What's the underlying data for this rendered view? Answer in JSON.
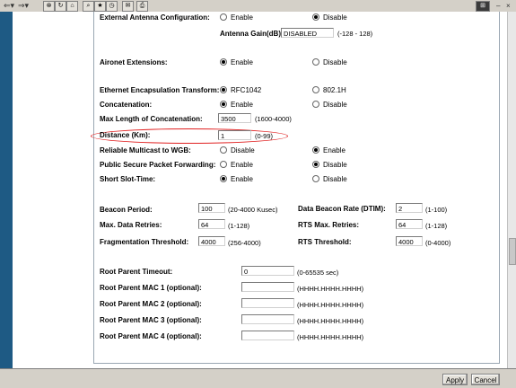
{
  "toolbar": {
    "icons": [
      "back-arrow-icon",
      "forward-arrow-icon",
      "stop-icon",
      "refresh-icon",
      "home-icon",
      "search-icon",
      "favorites-icon",
      "history-icon",
      "mail-icon",
      "print-icon"
    ],
    "window_controls": [
      "–",
      "×"
    ]
  },
  "form": {
    "ext_antenna": {
      "label": "External Antenna Configuration:",
      "opt1": "Enable",
      "opt2": "Disable"
    },
    "antenna_gain": {
      "label": "Antenna Gain(dB):",
      "value": "DISABLED",
      "hint": "(-128 - 128)"
    },
    "aironet": {
      "label": "Aironet Extensions:",
      "opt1": "Enable",
      "opt2": "Disable"
    },
    "ethernet_encap": {
      "label": "Ethernet Encapsulation Transform:",
      "opt1": "RFC1042",
      "opt2": "802.1H"
    },
    "concatenation": {
      "label": "Concatenation:",
      "opt1": "Enable",
      "opt2": "Disable"
    },
    "max_concat": {
      "label": "Max Length of Concatenation:",
      "value": "3500",
      "hint": "(1600-4000)"
    },
    "distance": {
      "label": "Distance (Km):",
      "value": "1",
      "hint": "(0-99)"
    },
    "reliable_multicast": {
      "label": "Reliable Multicast to WGB:",
      "opt1": "Disable",
      "opt2": "Enable"
    },
    "public_secure": {
      "label": "Public Secure Packet Forwarding:",
      "opt1": "Enable",
      "opt2": "Disable"
    },
    "short_slot": {
      "label": "Short Slot-Time:",
      "opt1": "Enable",
      "opt2": "Disable"
    },
    "beacon_period": {
      "label": "Beacon Period:",
      "value": "100",
      "hint": "(20-4000 Kusec)"
    },
    "data_beacon": {
      "label": "Data Beacon Rate (DTIM):",
      "value": "2",
      "hint": "(1-100)"
    },
    "max_data_retries": {
      "label": "Max. Data Retries:",
      "value": "64",
      "hint": "(1-128)"
    },
    "rts_max_retries": {
      "label": "RTS Max. Retries:",
      "value": "64",
      "hint": "(1-128)"
    },
    "frag_threshold": {
      "label": "Fragmentation Threshold:",
      "value": "4000",
      "hint": "(256-4000)"
    },
    "rts_threshold": {
      "label": "RTS Threshold:",
      "value": "4000",
      "hint": "(0-4000)"
    },
    "root_parent_timeout": {
      "label": "Root Parent Timeout:",
      "value": "0",
      "hint": "(0-65535 sec)"
    },
    "root_mac1": {
      "label": "Root Parent MAC 1 (optional):",
      "value": "",
      "hint": "(HHHH.HHHH.HHHH)"
    },
    "root_mac2": {
      "label": "Root Parent MAC 2 (optional):",
      "value": "",
      "hint": "(HHHH.HHHH.HHHH)"
    },
    "root_mac3": {
      "label": "Root Parent MAC 3 (optional):",
      "value": "",
      "hint": "(HHHH.HHHH.HHHH)"
    },
    "root_mac4": {
      "label": "Root Parent MAC 4 (optional):",
      "value": "",
      "hint": "(HHHH.HHHH.HHHH)"
    }
  },
  "buttons": {
    "apply": "Apply",
    "cancel": "Cancel"
  },
  "colors": {
    "highlight": "#e02020",
    "sidebar": "#1e5a84"
  }
}
